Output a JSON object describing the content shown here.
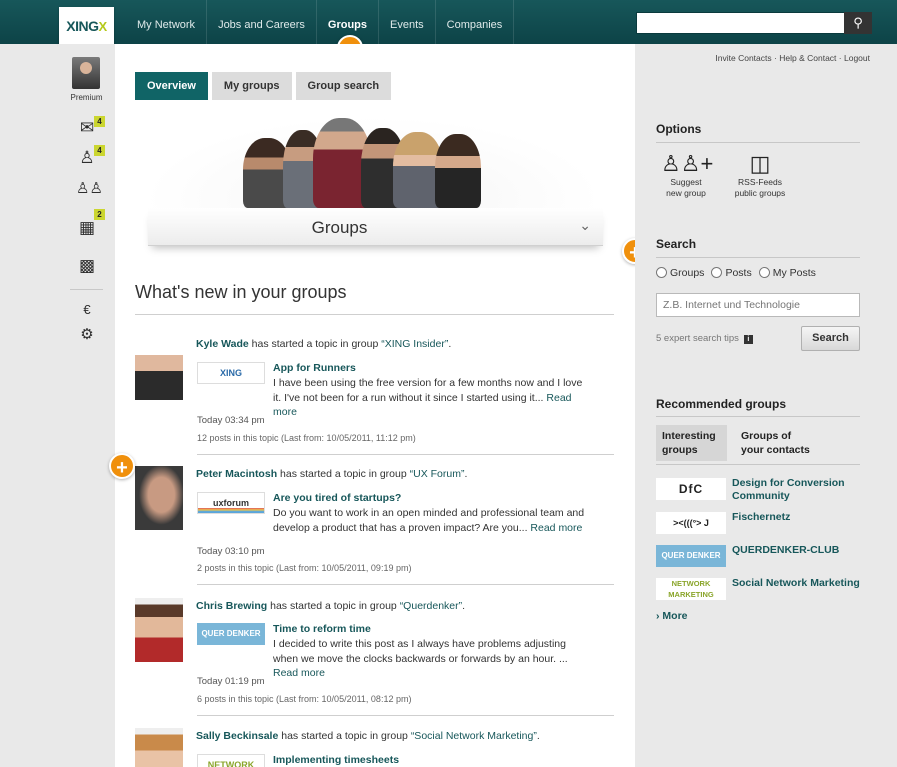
{
  "brand": {
    "logo_text": "XING",
    "logo_mark": "X"
  },
  "nav": [
    {
      "label": "My Network"
    },
    {
      "label": "Jobs and Careers"
    },
    {
      "label": "Groups"
    },
    {
      "label": "Events"
    },
    {
      "label": "Companies"
    }
  ],
  "search_top": {
    "placeholder": "",
    "button_icon": "search-icon"
  },
  "leftrail": {
    "premium_label": "Premium",
    "badges": {
      "messages": "4",
      "contacts": "4",
      "calendar": "2"
    }
  },
  "tabs": [
    {
      "label": "Overview"
    },
    {
      "label": "My groups"
    },
    {
      "label": "Group search"
    }
  ],
  "hero": {
    "title": "Groups"
  },
  "feed": {
    "title": "What's new in your groups",
    "items": [
      {
        "name": "Kyle Wade",
        "action": " has started a topic in group ",
        "group": "“XING Insider”",
        "suffix": ".",
        "logo": "XING",
        "topic": "App for Runners",
        "text": "I have been using the free version for a few months now and I love it. I've not been for a run without it since I started using it...",
        "more": "Read more",
        "time": "Today 03:34 pm",
        "posts": "12 posts in this topic (Last from: 10/05/2011, 11:12 pm)"
      },
      {
        "name": "Peter Macintosh",
        "action": " has started a topic in group ",
        "group": "“UX Forum”",
        "suffix": ".",
        "logo": "uxforum",
        "topic": "Are you tired of startups?",
        "text": "Do you want to work in an open minded and professional team and develop a product that has a proven impact? Are you...",
        "more": "Read more",
        "time": "Today 03:10 pm",
        "posts": "2 posts in this topic (Last from: 10/05/2011, 09:19 pm)"
      },
      {
        "name": "Chris Brewing",
        "action": " has started a topic in group ",
        "group": "“Querdenker”",
        "suffix": ".",
        "logo": "QUER DENKER",
        "topic": "Time to reform time",
        "text": "I decided to write this post as I always have problems adjusting when we move the clocks backwards or forwards by an hour. ...",
        "more": "Read more",
        "time": "Today 01:19 pm",
        "posts": "6 posts in this topic (Last from: 10/05/2011, 08:12 pm)"
      },
      {
        "name": "Sally Beckinsale",
        "action": " has started a topic in group ",
        "group": "“Social Network Marketing”",
        "suffix": ".",
        "logo": "NETWORK",
        "topic": "Implementing timesheets"
      }
    ]
  },
  "toplinks": {
    "invite": "Invite Contacts",
    "help": "Help & Contact",
    "logout": "Logout",
    "sep": "·"
  },
  "options": {
    "title": "Options",
    "suggest": {
      "line1": "Suggest",
      "line2": "new group"
    },
    "rss": {
      "line1": "RSS-Feeds",
      "line2": "public groups"
    }
  },
  "search": {
    "title": "Search",
    "radios": [
      "Groups",
      "Posts",
      "My Posts"
    ],
    "placeholder": "Z.B. Internet und Technologie",
    "tips": "5 expert search tips",
    "tips_icon": "i",
    "button": "Search"
  },
  "recommended": {
    "title": "Recommended groups",
    "tabs": [
      {
        "line1": "Interesting",
        "line2": "groups"
      },
      {
        "line1": "Groups of",
        "line2": "your contacts"
      }
    ],
    "items": [
      {
        "logo": "DfC",
        "name": "Design for Conversion Community"
      },
      {
        "logo": "><(((°> J",
        "name": "Fischernetz"
      },
      {
        "logo": "QUER DENKER",
        "name": "QUERDENKER-CLUB"
      },
      {
        "logo": "NETWORK MARKETING",
        "name": "Social Network Marketing"
      }
    ],
    "more": "More"
  },
  "colors": {
    "accent": "#106466",
    "link": "#17575a",
    "badge": "#cbd630",
    "plus": "#f0900c"
  }
}
